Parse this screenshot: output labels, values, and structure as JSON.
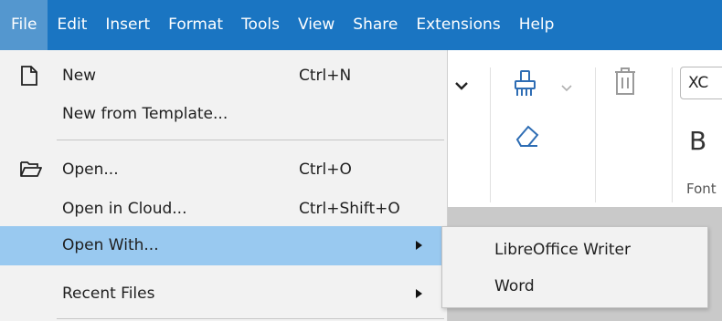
{
  "menubar": {
    "items": [
      "File",
      "Edit",
      "Insert",
      "Format",
      "Tools",
      "View",
      "Share",
      "Extensions",
      "Help"
    ],
    "active": "File"
  },
  "toolbar": {
    "font_name": "XC",
    "bold_label": "B",
    "font_group_label": "Font"
  },
  "file_menu": {
    "new_label": "New",
    "new_shortcut": "Ctrl+N",
    "new_template_label": "New from Template...",
    "open_label": "Open...",
    "open_shortcut": "Ctrl+O",
    "open_cloud_label": "Open in Cloud...",
    "open_cloud_shortcut": "Ctrl+Shift+O",
    "open_with_label": "Open With...",
    "recent_label": "Recent Files"
  },
  "open_with_submenu": {
    "items": [
      "LibreOffice Writer",
      "Word"
    ]
  },
  "colors": {
    "menubar_bg": "#1a75c2",
    "menubar_active": "#5497cf",
    "highlight": "#99c9f0",
    "menu_bg": "#f2f2f2"
  },
  "icons": {
    "new": "file-icon",
    "open": "folder-open-icon",
    "paint_format": "paint-bucket-icon",
    "clear_format": "eraser-icon",
    "delete": "trash-icon"
  }
}
